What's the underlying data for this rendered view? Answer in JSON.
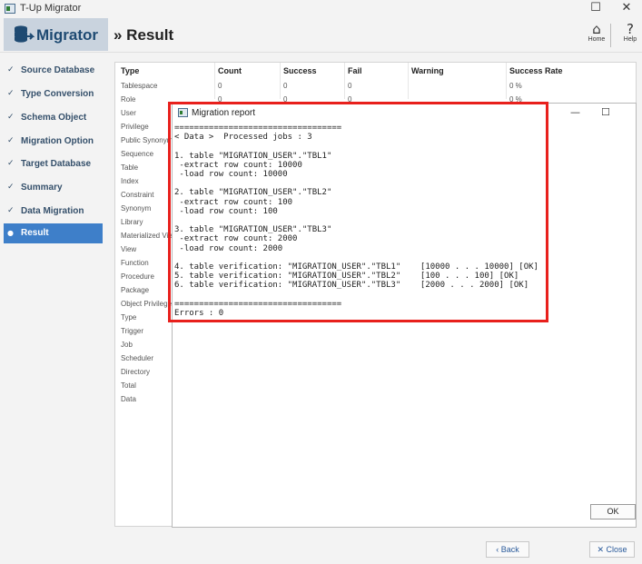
{
  "window": {
    "title": "T-Up Migrator",
    "minimize": "—",
    "maximize": "☐",
    "close": "✕"
  },
  "header": {
    "brand": "Migrator",
    "page_title": "» Result",
    "home_label": "Home",
    "help_label": "Help"
  },
  "sidebar": {
    "items": [
      {
        "label": "Source Database",
        "mark": "✓"
      },
      {
        "label": "Type Conversion",
        "mark": "✓"
      },
      {
        "label": "Schema Object",
        "mark": "✓"
      },
      {
        "label": "Migration Option",
        "mark": "✓"
      },
      {
        "label": "Target Database",
        "mark": "✓"
      },
      {
        "label": "Summary",
        "mark": "✓"
      },
      {
        "label": "Data Migration",
        "mark": "✓"
      },
      {
        "label": "Result",
        "mark": "●"
      }
    ]
  },
  "table": {
    "headers": [
      "Type",
      "Count",
      "Success",
      "Fail",
      "Warning",
      "Success Rate"
    ],
    "rows": [
      [
        "Tablespace",
        "0",
        "0",
        "0",
        "",
        "0 %"
      ],
      [
        "Role",
        "0",
        "0",
        "0",
        "",
        "0 %"
      ],
      [
        "User",
        "",
        "",
        "",
        "",
        ""
      ],
      [
        "Privilege",
        "",
        "",
        "",
        "",
        ""
      ],
      [
        "Public Synonym",
        "",
        "",
        "",
        "",
        ""
      ],
      [
        "Sequence",
        "",
        "",
        "",
        "",
        ""
      ],
      [
        "Table",
        "",
        "",
        "",
        "",
        ""
      ],
      [
        "Index",
        "",
        "",
        "",
        "",
        ""
      ],
      [
        "Constraint",
        "",
        "",
        "",
        "",
        ""
      ],
      [
        "Synonym",
        "",
        "",
        "",
        "",
        ""
      ],
      [
        "Library",
        "",
        "",
        "",
        "",
        ""
      ],
      [
        "Materialized View",
        "",
        "",
        "",
        "",
        ""
      ],
      [
        "View",
        "",
        "",
        "",
        "",
        ""
      ],
      [
        "Function",
        "",
        "",
        "",
        "",
        ""
      ],
      [
        "Procedure",
        "",
        "",
        "",
        "",
        ""
      ],
      [
        "Package",
        "",
        "",
        "",
        "",
        ""
      ],
      [
        "Object Privilege",
        "",
        "",
        "",
        "",
        ""
      ],
      [
        "Type",
        "",
        "",
        "",
        "",
        ""
      ],
      [
        "Trigger",
        "",
        "",
        "",
        "",
        ""
      ],
      [
        "Job",
        "",
        "",
        "",
        "",
        ""
      ],
      [
        "Scheduler",
        "",
        "",
        "",
        "",
        ""
      ],
      [
        "Directory",
        "",
        "",
        "",
        "",
        ""
      ],
      [
        "Total",
        "",
        "",
        "",
        "",
        ""
      ],
      [
        "Data",
        "",
        "",
        "",
        "",
        ""
      ]
    ]
  },
  "report": {
    "title": "Migration report",
    "minimize": "—",
    "maximize": "☐",
    "text": "==================================\n< Data >  Processed jobs : 3\n\n1. table \"MIGRATION_USER\".\"TBL1\"\n -extract row count: 10000\n -load row count: 10000\n\n2. table \"MIGRATION_USER\".\"TBL2\"\n -extract row count: 100\n -load row count: 100\n\n3. table \"MIGRATION_USER\".\"TBL3\"\n -extract row count: 2000\n -load row count: 2000\n\n4. table verification: \"MIGRATION_USER\".\"TBL1\"    [10000 . . . 10000] [OK]\n5. table verification: \"MIGRATION_USER\".\"TBL2\"    [100 . . . 100] [OK]\n6. table verification: \"MIGRATION_USER\".\"TBL3\"    [2000 . . . 2000] [OK]\n\n==================================\nErrors : 0",
    "ok_label": "OK"
  },
  "footer": {
    "back_label": "‹ Back",
    "close_label": "✕ Close"
  },
  "colors": {
    "accent": "#3e7fc9",
    "highlight": "#e8201c",
    "brand_bg": "#c9d3de"
  }
}
